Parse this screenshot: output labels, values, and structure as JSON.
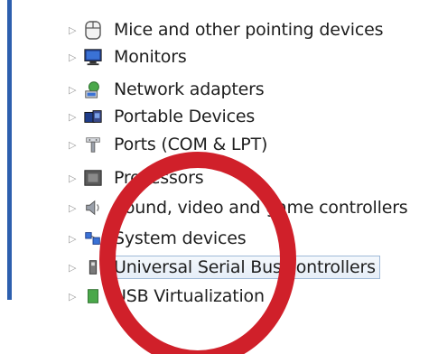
{
  "device_tree": {
    "items": [
      {
        "label": "Mice and other pointing devices",
        "icon": "mouse-icon"
      },
      {
        "label": "Monitors",
        "icon": "monitor-icon"
      },
      {
        "label": "Network adapters",
        "icon": "network-adapter-icon"
      },
      {
        "label": "Portable Devices",
        "icon": "portable-device-icon"
      },
      {
        "label": "Ports (COM & LPT)",
        "icon": "port-icon"
      },
      {
        "label": "Processors",
        "icon": "processor-icon"
      },
      {
        "label": "Sound, video and game controllers",
        "icon": "speaker-icon"
      },
      {
        "label": "System devices",
        "icon": "system-devices-icon"
      },
      {
        "label": "Universal Serial Bus controllers",
        "icon": "usb-icon",
        "selected": true
      },
      {
        "label": "USB Virtualization",
        "icon": "usb-virtualization-icon"
      }
    ]
  },
  "annotation": {
    "type": "circle",
    "color": "#d0202a"
  }
}
